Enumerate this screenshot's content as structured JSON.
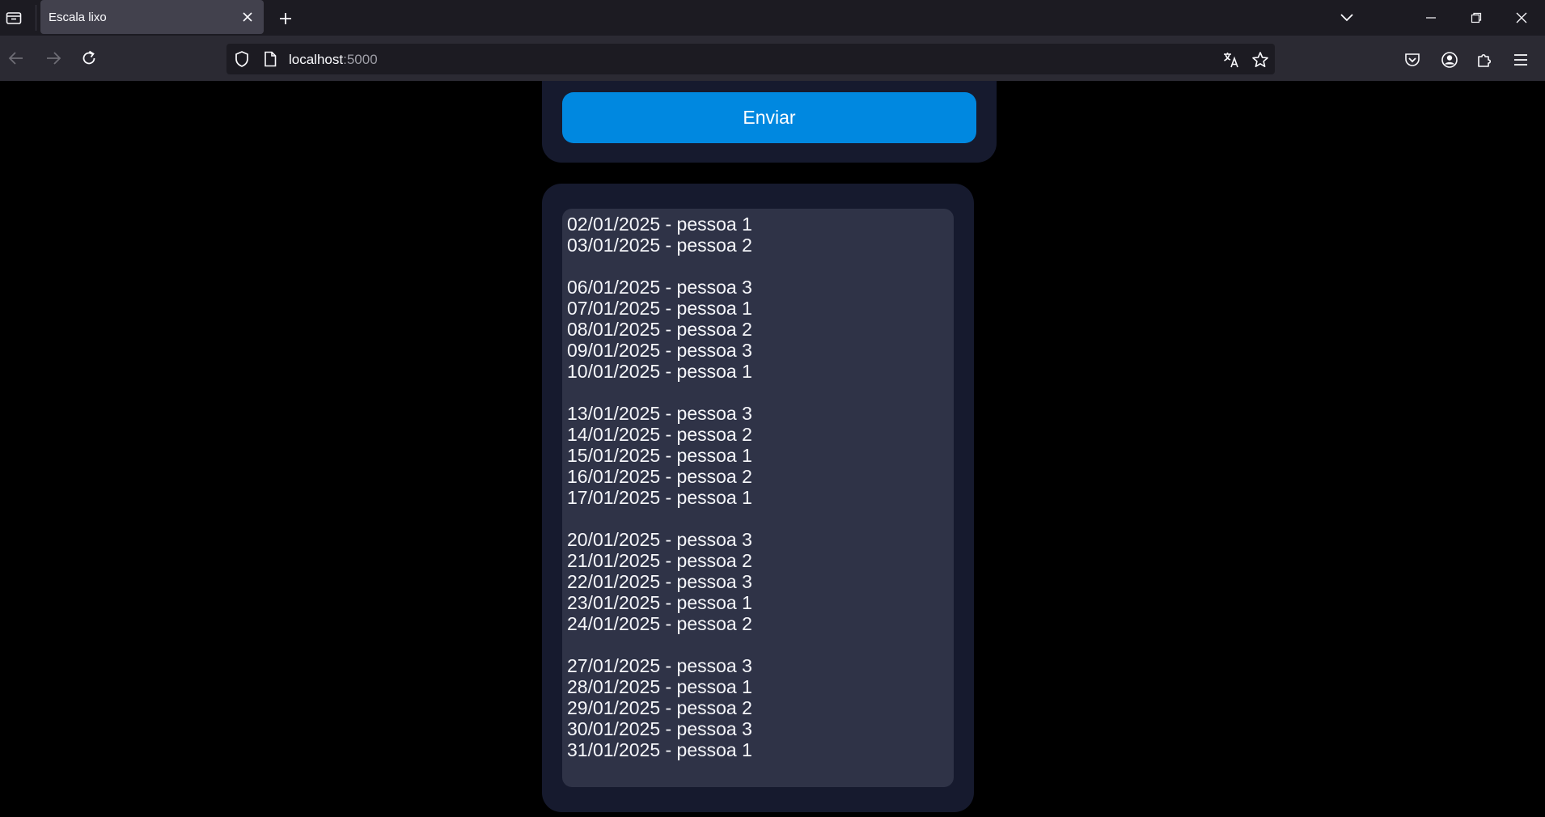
{
  "browser": {
    "tab_title": "Escala lixo",
    "url_host": "localhost",
    "url_port": ":5000"
  },
  "form": {
    "submit_label": "Enviar"
  },
  "schedule": [
    "02/01/2025 - pessoa 1",
    "03/01/2025 - pessoa 2",
    "",
    "06/01/2025 - pessoa 3",
    "07/01/2025 - pessoa 1",
    "08/01/2025 - pessoa 2",
    "09/01/2025 - pessoa 3",
    "10/01/2025 - pessoa 1",
    "",
    "13/01/2025 - pessoa 3",
    "14/01/2025 - pessoa 2",
    "15/01/2025 - pessoa 1",
    "16/01/2025 - pessoa 2",
    "17/01/2025 - pessoa 1",
    "",
    "20/01/2025 - pessoa 3",
    "21/01/2025 - pessoa 2",
    "22/01/2025 - pessoa 3",
    "23/01/2025 - pessoa 1",
    "24/01/2025 - pessoa 2",
    "",
    "27/01/2025 - pessoa 3",
    "28/01/2025 - pessoa 1",
    "29/01/2025 - pessoa 2",
    "30/01/2025 - pessoa 3",
    "31/01/2025 - pessoa 1"
  ],
  "colors": {
    "page_background": "#000000",
    "card_background": "#161a2e",
    "textarea_background": "#2f3347",
    "button_blue": "#0088e0"
  }
}
